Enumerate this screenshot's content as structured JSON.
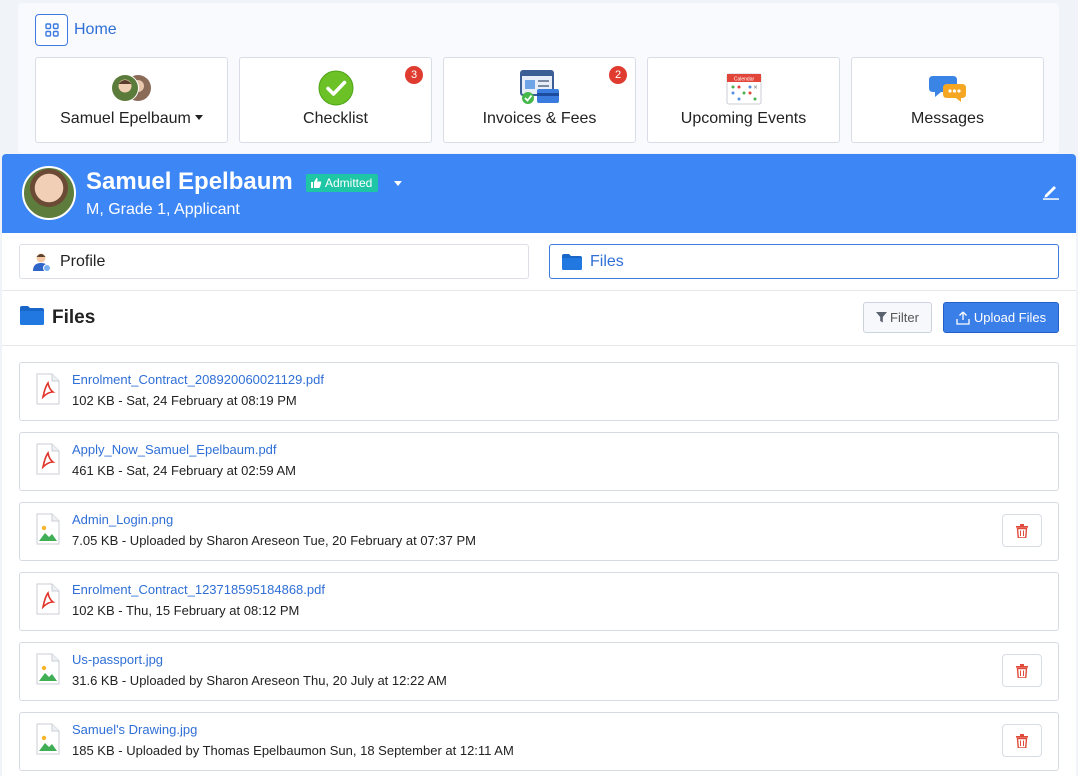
{
  "nav": {
    "home_label": "Home",
    "home_icon": "grid-icon"
  },
  "tiles": [
    {
      "label": "Samuel Epelbaum",
      "icon": "avatars-icon",
      "badge": null
    },
    {
      "label": "Checklist",
      "icon": "check-circle-icon",
      "badge": "3"
    },
    {
      "label": "Invoices & Fees",
      "icon": "invoice-card-icon",
      "badge": "2"
    },
    {
      "label": "Upcoming Events",
      "icon": "calendar-icon",
      "badge": null,
      "calendar_word": "Calendar"
    },
    {
      "label": "Messages",
      "icon": "chat-bubbles-icon",
      "badge": null
    }
  ],
  "student": {
    "name": "Samuel Epelbaum",
    "status": "Admitted",
    "subtitle": "M, Grade 1, Applicant"
  },
  "tabs": {
    "profile": "Profile",
    "files": "Files"
  },
  "files_section": {
    "title": "Files",
    "filter_label": "Filter",
    "upload_label": "Upload Files"
  },
  "files": [
    {
      "name": "Enrolment_Contract_208920060021129.pdf",
      "meta": "102 KB - Sat, 24 February at 08:19 PM",
      "type": "pdf",
      "deletable": false
    },
    {
      "name": "Apply_Now_Samuel_Epelbaum.pdf",
      "meta": "461 KB - Sat, 24 February at 02:59 AM",
      "type": "pdf",
      "deletable": false
    },
    {
      "name": "Admin_Login.png",
      "meta": "7.05 KB - Uploaded by Sharon Areseon Tue, 20 February at 07:37 PM",
      "type": "image",
      "deletable": true
    },
    {
      "name": "Enrolment_Contract_123718595184868.pdf",
      "meta": "102 KB - Thu, 15 February at 08:12 PM",
      "type": "pdf",
      "deletable": false
    },
    {
      "name": "Us-passport.jpg",
      "meta": "31.6 KB - Uploaded by Sharon Areseon Thu, 20 July at 12:22 AM",
      "type": "image",
      "deletable": true
    },
    {
      "name": "Samuel's Drawing.jpg",
      "meta": "185 KB - Uploaded by Thomas Epelbaumon Sun, 18 September at 12:11 AM",
      "type": "image",
      "deletable": true
    }
  ],
  "colors": {
    "banner": "#3d86f6",
    "link": "#2f6fd6",
    "status": "#1ec6a5",
    "badge": "#e03b2f",
    "delete": "#e04a3a"
  }
}
